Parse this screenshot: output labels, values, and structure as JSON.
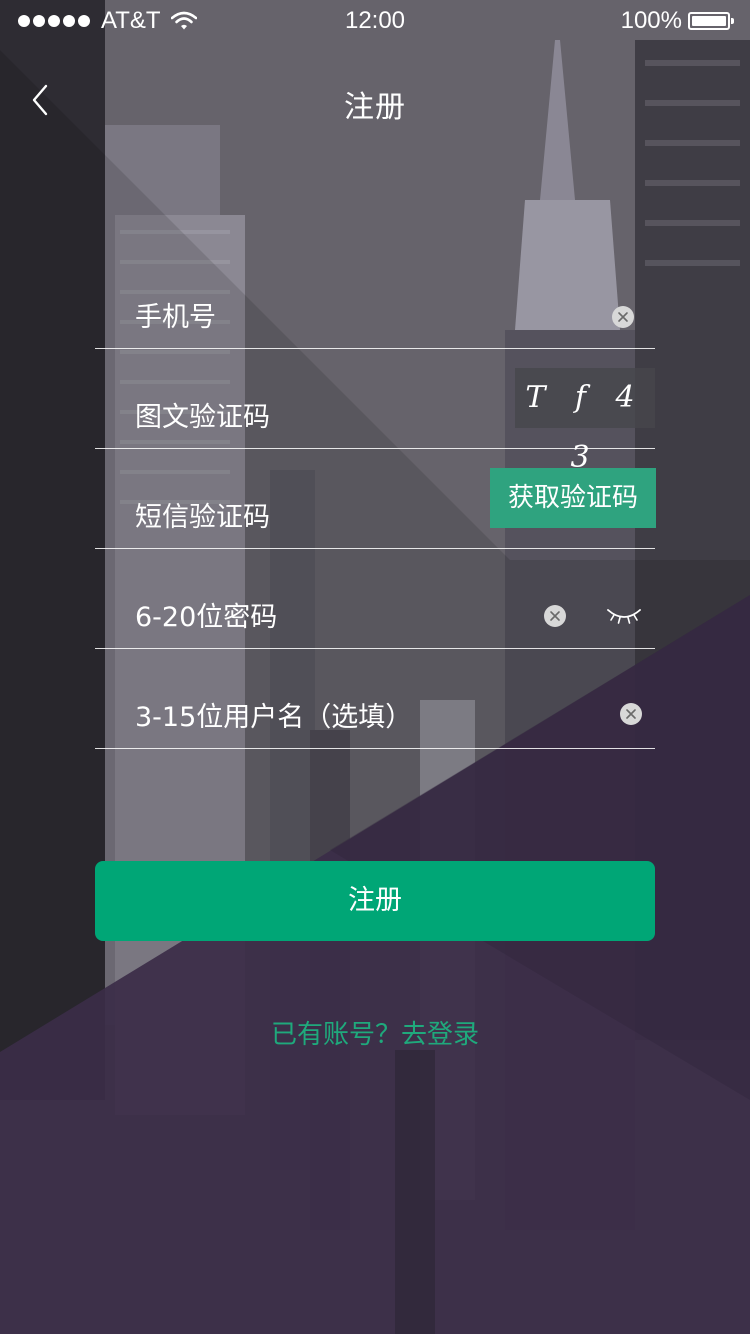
{
  "status_bar": {
    "carrier": "AT&T",
    "time": "12:00",
    "battery": "100%"
  },
  "nav": {
    "title": "注册"
  },
  "form": {
    "phone_placeholder": "手机号",
    "captcha_placeholder": "图文验证码",
    "captcha_code": "T f 4 3",
    "sms_placeholder": "短信验证码",
    "sms_button": "获取验证码",
    "password_placeholder": "6-20位密码",
    "username_placeholder": "3-15位用户名（选填）"
  },
  "actions": {
    "submit_label": "注册",
    "login_link": "已有账号？去登录"
  },
  "colors": {
    "accent": "#00a676",
    "link": "#1fa97c",
    "overlay_purple": "#3b2d48"
  }
}
